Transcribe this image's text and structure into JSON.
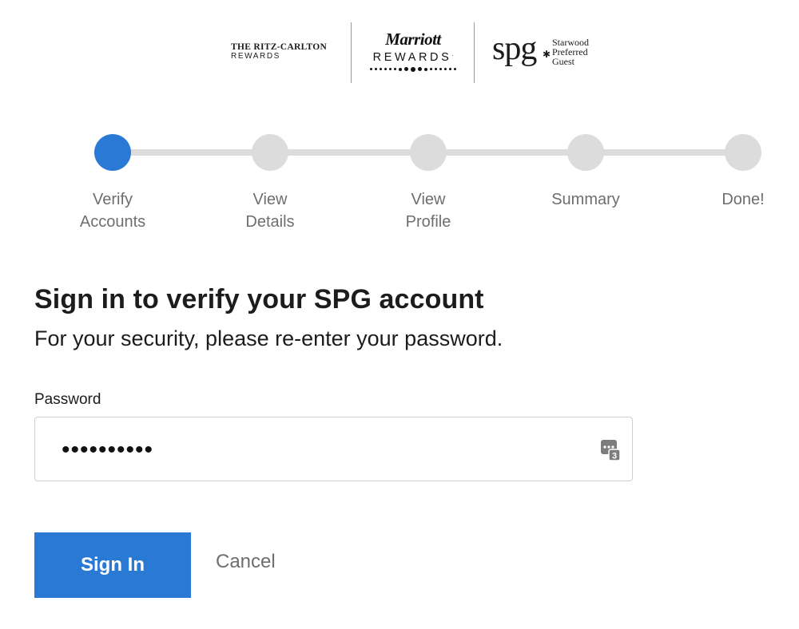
{
  "brands": {
    "ritz": {
      "line1": "THE RITZ-CARLTON",
      "line2": "REWARDS"
    },
    "marriott": {
      "script": "Marriott",
      "rewards": "REWARDS",
      "mark": "."
    },
    "spg": {
      "letters": "spg",
      "star": "✱",
      "words": [
        "Starwood",
        "Preferred",
        "Guest"
      ]
    }
  },
  "stepper": {
    "steps": [
      {
        "label": "Verify\nAccounts",
        "state": "active"
      },
      {
        "label": "View\nDetails",
        "state": "pending"
      },
      {
        "label": "View\nProfile",
        "state": "pending"
      },
      {
        "label": "Summary",
        "state": "pending"
      },
      {
        "label": "Done!",
        "state": "pending"
      }
    ],
    "colors": {
      "active": "#2a79d4",
      "pending": "#dcdcdc"
    }
  },
  "form": {
    "title": "Sign in to verify your SPG account",
    "subtitle": "For your security, please re-enter your password.",
    "password_label": "Password",
    "password_value": "••••••••••",
    "password_icon": "password-manager-key-icon",
    "password_icon_badge": "3",
    "signin_label": "Sign In",
    "cancel_label": "Cancel",
    "accent_color": "#2a79d4"
  }
}
